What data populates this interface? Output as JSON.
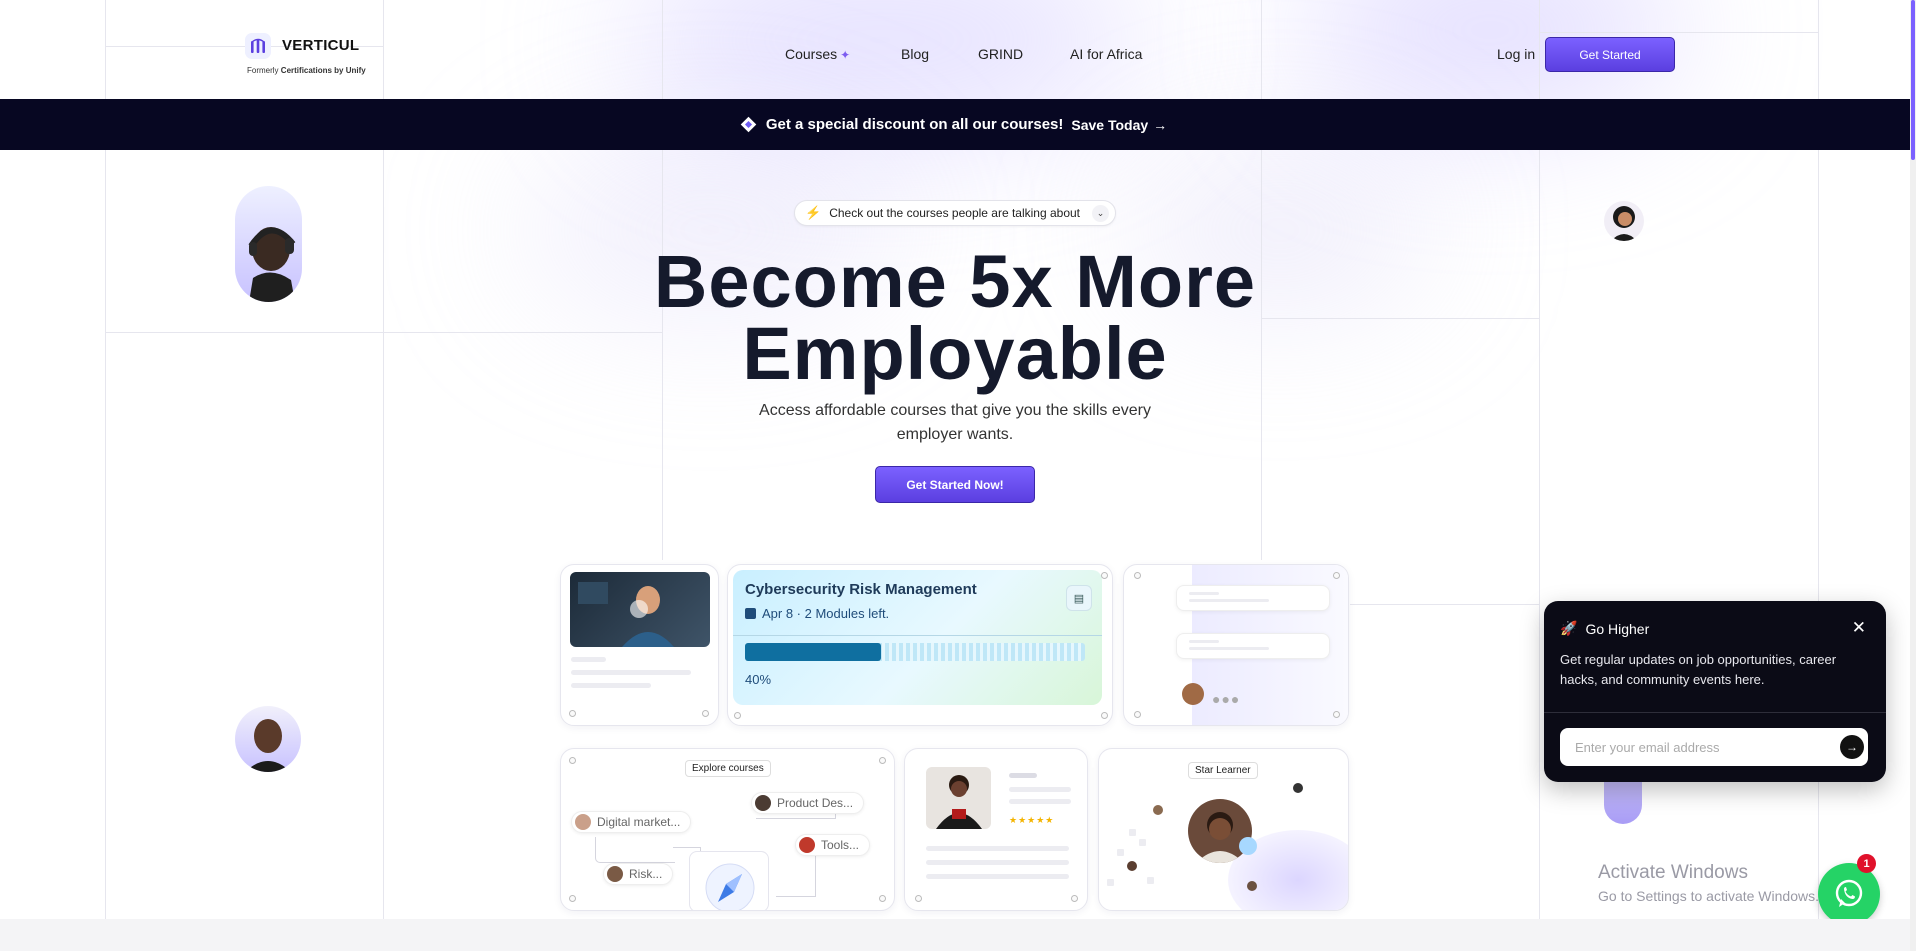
{
  "brand": {
    "name": "VERTICUL",
    "subtitle_prefix": "Formerly",
    "subtitle_bold": "Certifications by Unify"
  },
  "nav": {
    "courses": "Courses",
    "blog": "Blog",
    "grind": "GRIND",
    "ai_africa": "AI for Africa",
    "login": "Log in",
    "get_started": "Get Started"
  },
  "banner": {
    "text": "Get a special discount on all our courses!",
    "cta": "Save Today",
    "arrow": "→"
  },
  "hero": {
    "pill_text": "Check out the courses people are talking about",
    "headline_line1": "Become 5x More",
    "headline_line2": "Employable",
    "subline": "Access affordable courses that give you the skills every employer wants.",
    "cta": "Get Started Now!"
  },
  "course_card": {
    "title": "Cybersecurity Risk Management",
    "meta": "Apr 8 · 2 Modules left.",
    "progress_label": "40%",
    "progress": 0.4
  },
  "explore": {
    "tag": "Explore courses",
    "items": [
      "Digital market...",
      "Product Des...",
      "Tools...",
      "Risk..."
    ]
  },
  "star_learner": {
    "tag": "Star Learner",
    "stars": "★★★★★"
  },
  "popup": {
    "title": "Go Higher",
    "body": "Get regular updates on job opportunities, career hacks, and community events here.",
    "email_placeholder": "Enter your email address",
    "close": "✕"
  },
  "watermark": {
    "title": "Activate Windows",
    "subtitle": "Go to Settings to activate Windows."
  },
  "whatsapp": {
    "badge": "1"
  },
  "colors": {
    "accent": "#6b4ff0",
    "banner_bg": "#070722",
    "headline": "#151a2c",
    "whatsapp": "#25d366"
  }
}
